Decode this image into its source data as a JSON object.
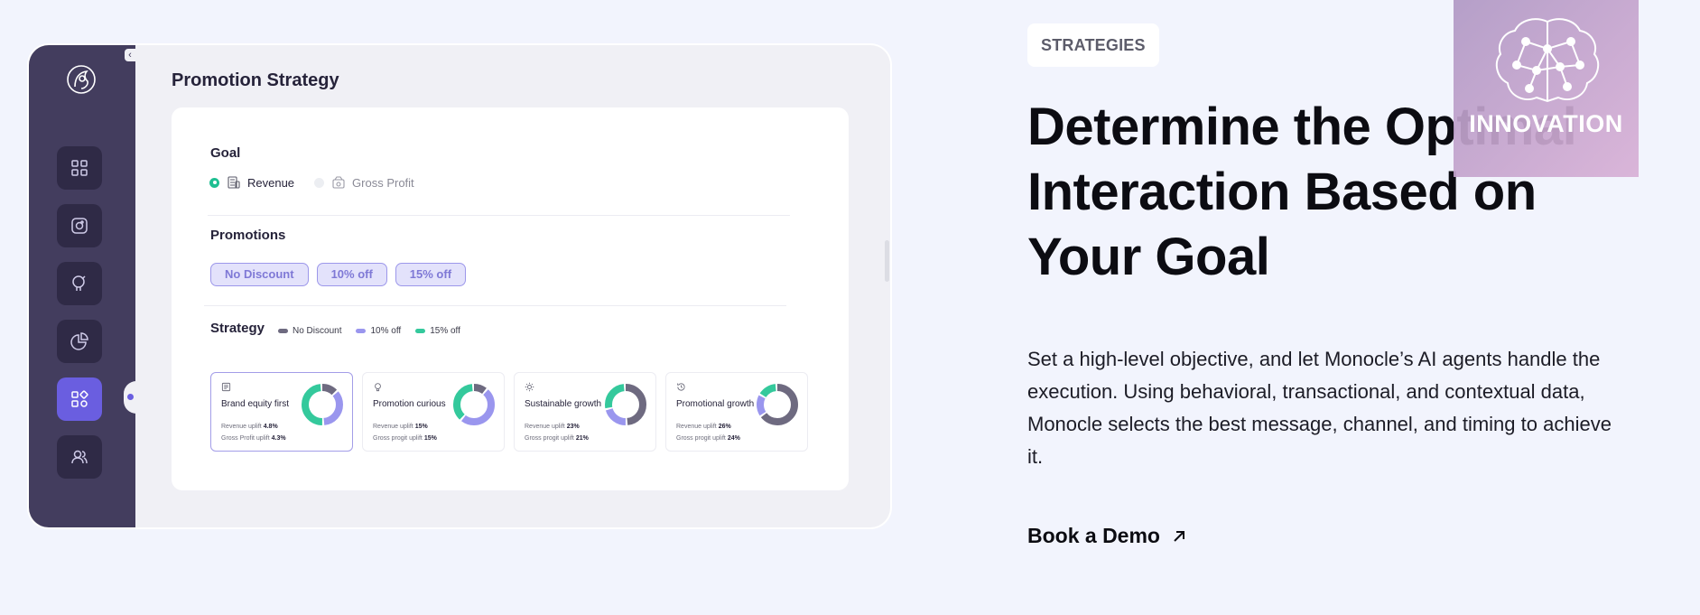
{
  "app": {
    "title": "Promotion Strategy",
    "goal": {
      "label": "Goal",
      "options": [
        {
          "label": "Revenue",
          "selected": true
        },
        {
          "label": "Gross Profit",
          "selected": false
        }
      ]
    },
    "promotions": {
      "label": "Promotions",
      "chips": [
        "No Discount",
        "10% off",
        "15% off"
      ]
    },
    "strategy": {
      "label": "Strategy",
      "legend": [
        {
          "label": "No Discount",
          "color": "#6e6a80"
        },
        {
          "label": "10% off",
          "color": "#9a96ee"
        },
        {
          "label": "15% off",
          "color": "#34c99c"
        }
      ],
      "cards": [
        {
          "title": "Brand equity first",
          "icon": "document-icon",
          "stat1_label": "Revenue uplift",
          "stat1_value": "4.8%",
          "stat2_label": "Gross Profit uplift",
          "stat2_value": "4.3%",
          "selected": true,
          "mix": [
            0.14,
            0.36,
            0.5
          ]
        },
        {
          "title": "Promotion curious",
          "icon": "lightbulb-icon",
          "stat1_label": "Revenue uplift",
          "stat1_value": "15%",
          "stat2_label": "Gross progit uplift",
          "stat2_value": "15%",
          "selected": false,
          "mix": [
            0.12,
            0.5,
            0.38
          ]
        },
        {
          "title": "Sustainable growth",
          "icon": "sun-icon",
          "stat1_label": "Revenue uplift",
          "stat1_value": "23%",
          "stat2_label": "Gross progit uplift",
          "stat2_value": "21%",
          "selected": false,
          "mix": [
            0.5,
            0.22,
            0.28
          ]
        },
        {
          "title": "Promotional growth",
          "icon": "history-icon",
          "stat1_label": "Revenue uplift",
          "stat1_value": "26%",
          "stat2_label": "Gross progit uplift",
          "stat2_value": "24%",
          "selected": false,
          "mix": [
            0.66,
            0.18,
            0.16
          ]
        }
      ]
    }
  },
  "marketing": {
    "tag": "STRATEGIES",
    "headline_lines": [
      "Determine the Optimal",
      "Interaction Based on",
      "Your Goal"
    ],
    "body": "Set a high-level objective, and let Monocle’s AI agents handle the execution. Using behavioral, transactional, and contextual data, Monocle selects the best message, channel, and timing to achieve it.",
    "cta": "Book a Demo"
  },
  "watermark": {
    "text": "INNOVATION"
  },
  "colors": {
    "rail": "#433d5e",
    "accent": "#6a5ee0",
    "green": "#1fbf92"
  }
}
